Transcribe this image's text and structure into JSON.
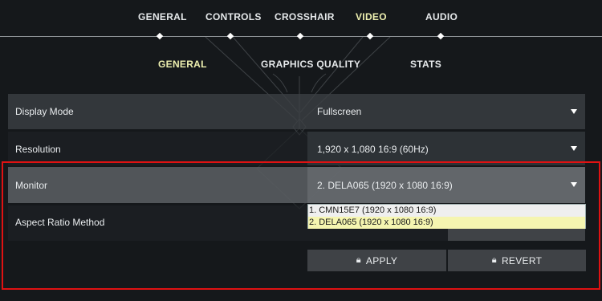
{
  "top_nav": {
    "tabs": [
      {
        "label": "GENERAL"
      },
      {
        "label": "CONTROLS"
      },
      {
        "label": "CROSSHAIR"
      },
      {
        "label": "VIDEO",
        "active": true
      },
      {
        "label": "AUDIO"
      }
    ]
  },
  "sub_nav": {
    "tabs": [
      {
        "label": "GENERAL",
        "active": true
      },
      {
        "label": "GRAPHICS QUALITY"
      },
      {
        "label": "STATS"
      }
    ]
  },
  "settings": {
    "display_mode": {
      "label": "Display Mode",
      "value": "Fullscreen"
    },
    "resolution": {
      "label": "Resolution",
      "value": "1,920 x 1,080 16:9 (60Hz)"
    },
    "monitor": {
      "label": "Monitor",
      "value": "2. DELA065 (1920 x  1080 16:9)"
    },
    "aspect_ratio": {
      "label": "Aspect Ratio Method",
      "value": ""
    }
  },
  "monitor_dropdown": {
    "options": [
      {
        "label": "1. CMN15E7 (1920 x  1080 16:9)"
      },
      {
        "label": "2. DELA065 (1920 x  1080 16:9)",
        "selected": true
      }
    ]
  },
  "buttons": {
    "apply": "APPLY",
    "revert": "REVERT"
  },
  "colors": {
    "accent": "#eef0b0",
    "highlight": "#e01212",
    "background": "#15181b"
  }
}
